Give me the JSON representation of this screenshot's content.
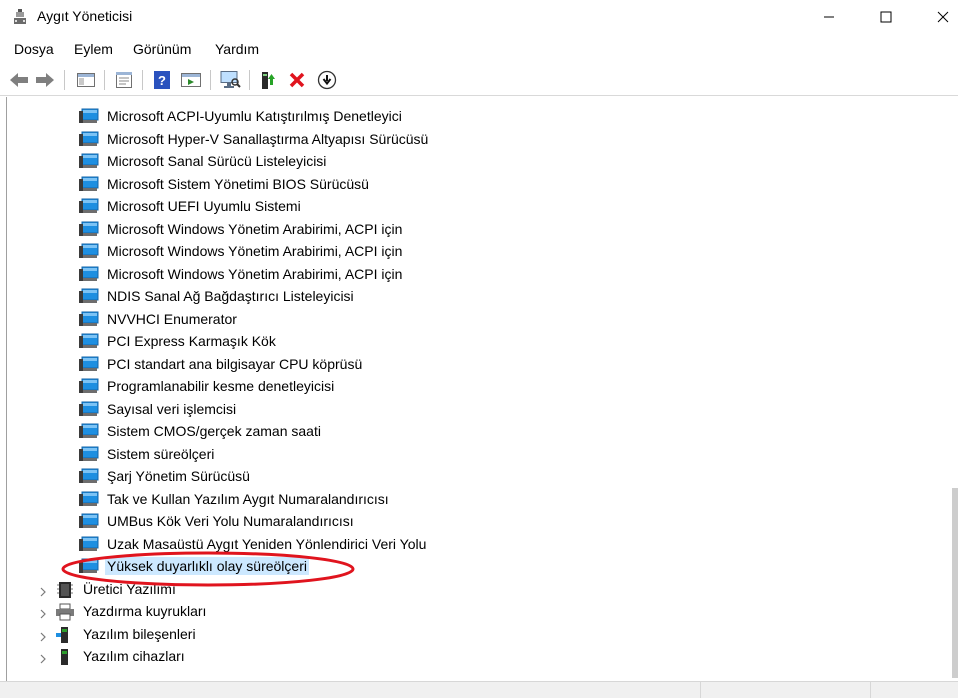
{
  "window": {
    "title": "Aygıt Yöneticisi",
    "controls": [
      "minimize-icon",
      "maximize-icon",
      "close-icon"
    ]
  },
  "menu": {
    "items": [
      "Dosya",
      "Eylem",
      "Görünüm",
      "Yardım"
    ]
  },
  "toolbar": {
    "buttons": [
      "back-arrow-icon",
      "forward-arrow-icon",
      "show-hide-console-tree-icon",
      "properties-icon",
      "help-icon",
      "action-pane-icon",
      "scan-hardware-icon",
      "update-driver-icon",
      "uninstall-device-icon",
      "disable-device-icon"
    ]
  },
  "tree": {
    "system_devices": [
      "Microsoft ACPI-Uyumlu Katıştırılmış Denetleyici",
      "Microsoft Hyper-V Sanallaştırma Altyapısı Sürücüsü",
      "Microsoft Sanal Sürücü Listeleyicisi",
      "Microsoft Sistem Yönetimi BIOS Sürücüsü",
      "Microsoft UEFI Uyumlu Sistemi",
      "Microsoft Windows Yönetim Arabirimi, ACPI için",
      "Microsoft Windows Yönetim Arabirimi, ACPI için",
      "Microsoft Windows Yönetim Arabirimi, ACPI için",
      "NDIS Sanal Ağ Bağdaştırıcı Listeleyicisi",
      "NVVHCI Enumerator",
      "PCI Express Karmaşık Kök",
      "PCI standart ana bilgisayar CPU köprüsü",
      "Programlanabilir kesme denetleyicisi",
      "Sayısal veri işlemcisi",
      "Sistem CMOS/gerçek zaman saati",
      "Sistem süreölçeri",
      "Şarj Yönetim Sürücüsü",
      "Tak ve Kullan Yazılım Aygıt Numaralandırıcısı",
      "UMBus Kök Veri Yolu Numaralandırıcısı",
      "Uzak Masaüstü Aygıt Yeniden Yönlendirici Veri Yolu",
      "Yüksek duyarlıklı olay süreölçeri"
    ],
    "selected_index": 20,
    "categories": [
      {
        "label": "Üretici Yazılımı",
        "icon": "firmware-chip-icon"
      },
      {
        "label": "Yazdırma kuyrukları",
        "icon": "printer-icon"
      },
      {
        "label": "Yazılım bileşenleri",
        "icon": "software-component-icon"
      },
      {
        "label": "Yazılım cihazları",
        "icon": "software-device-icon"
      }
    ]
  },
  "colors": {
    "selection": "#cce8ff",
    "annotation": "#e0141e",
    "device_icon": "#1e8fe1"
  }
}
